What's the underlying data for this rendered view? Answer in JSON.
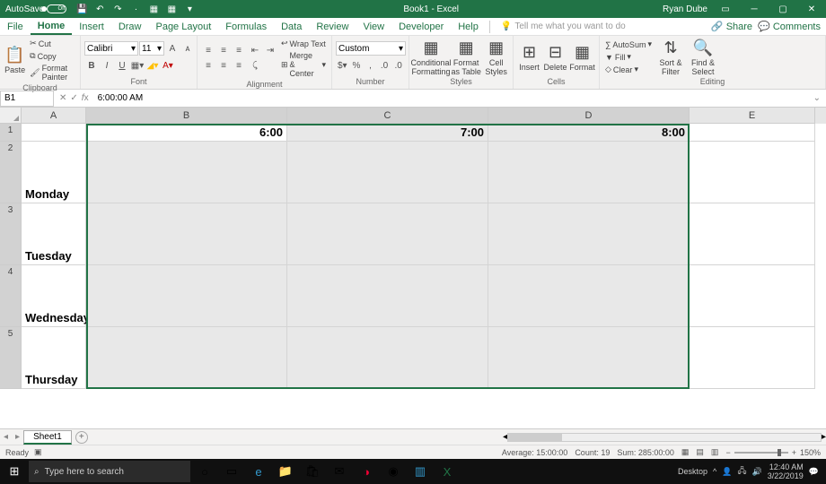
{
  "titlebar": {
    "autosave": "AutoSave",
    "autosave_state": "Off",
    "title": "Book1 - Excel",
    "user": "Ryan Dube"
  },
  "menubar": {
    "tabs": [
      "File",
      "Home",
      "Insert",
      "Draw",
      "Page Layout",
      "Formulas",
      "Data",
      "Review",
      "View",
      "Developer",
      "Help"
    ],
    "tell": "Tell me what you want to do",
    "share": "Share",
    "comments": "Comments"
  },
  "ribbon": {
    "clipboard": {
      "paste": "Paste",
      "cut": "Cut",
      "copy": "Copy",
      "fp": "Format Painter",
      "label": "Clipboard"
    },
    "font": {
      "name": "Calibri",
      "size": "11",
      "label": "Font"
    },
    "alignment": {
      "wrap": "Wrap Text",
      "merge": "Merge & Center",
      "label": "Alignment"
    },
    "number": {
      "format": "Custom",
      "label": "Number"
    },
    "styles": {
      "cf": "Conditional Formatting",
      "fat": "Format as Table",
      "cs": "Cell Styles",
      "label": "Styles"
    },
    "cells": {
      "insert": "Insert",
      "delete": "Delete",
      "format": "Format",
      "label": "Cells"
    },
    "editing": {
      "autosum": "AutoSum",
      "fill": "Fill",
      "clear": "Clear",
      "sort": "Sort & Filter",
      "find": "Find & Select",
      "label": "Editing"
    }
  },
  "formulabar": {
    "ref": "B1",
    "value": "6:00:00 AM"
  },
  "grid": {
    "cols": [
      "A",
      "B",
      "C",
      "D",
      "E"
    ],
    "rows": [
      "1",
      "2",
      "3",
      "4",
      "5"
    ],
    "r1": {
      "b": "6:00",
      "c": "7:00",
      "d": "8:00"
    },
    "r2": {
      "a": "Monday"
    },
    "r3": {
      "a": "Tuesday"
    },
    "r4": {
      "a": "Wednesday"
    },
    "r5": {
      "a": "Thursday"
    }
  },
  "tabstrip": {
    "sheet1": "Sheet1"
  },
  "statusbar": {
    "ready": "Ready",
    "avg": "Average: 15:00:00",
    "count": "Count: 19",
    "sum": "Sum: 285:00:00",
    "zoom": "150%"
  },
  "taskbar": {
    "search": "Type here to search",
    "desktop_label": "Desktop",
    "time": "12:40 AM",
    "date": "3/22/2019"
  }
}
